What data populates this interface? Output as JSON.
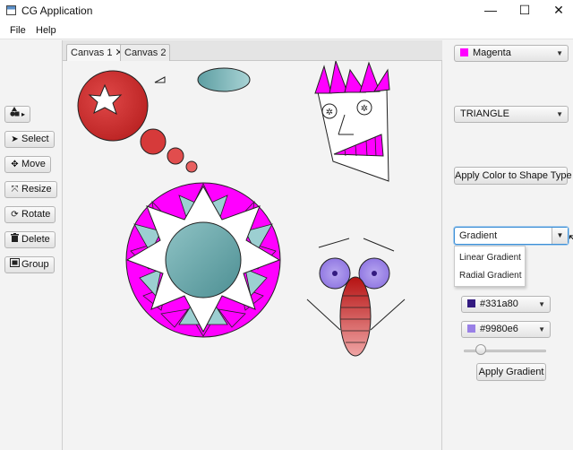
{
  "window": {
    "title": "CG Application",
    "minimize": "—",
    "maximize": "☐",
    "close": "✕"
  },
  "menu": {
    "file": "File",
    "help": "Help"
  },
  "toolbar": {
    "shapes_label": "▸",
    "select": "Select",
    "move": "Move",
    "resize": "Resize",
    "rotate": "Rotate",
    "delete": "Delete",
    "group": "Group"
  },
  "tabs": [
    {
      "label": "Canvas 1",
      "close": "✕"
    },
    {
      "label": "Canvas 2"
    }
  ],
  "right_panel": {
    "color_select": {
      "value": "Magenta",
      "swatch": "#ff00ff"
    },
    "shape_type_select": {
      "value": "TRIANGLE"
    },
    "apply_color_button": "Apply Color to Shape Type",
    "gradient_select": {
      "value": "Gradient"
    },
    "gradient_options": [
      "Linear Gradient",
      "Radial Gradient"
    ],
    "color1": {
      "value": "#331a80",
      "swatch": "#331a80"
    },
    "color2": {
      "value": "#9980e6",
      "swatch": "#9980e6"
    },
    "gradient_amount": 0.15,
    "apply_gradient_button": "Apply Gradient"
  },
  "colors": {
    "magenta": "#ff00ff",
    "red": "#d32f2f",
    "teal": "#7fb2b5",
    "lavender": "#9980e6"
  }
}
